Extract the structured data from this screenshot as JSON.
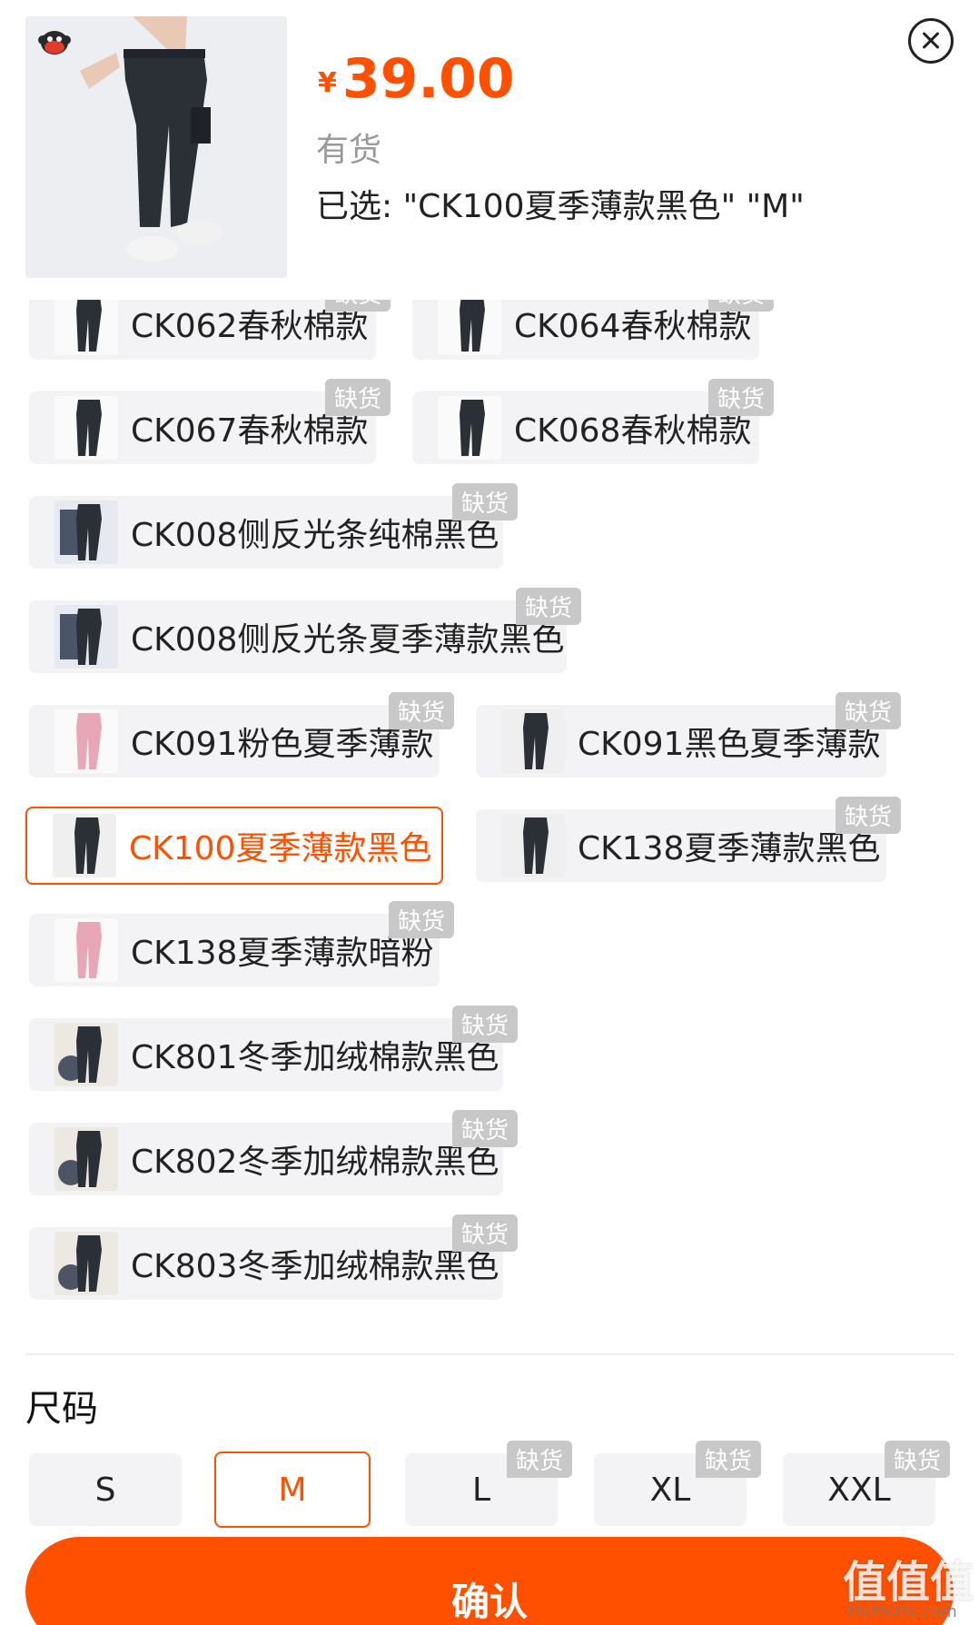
{
  "header": {
    "currency_symbol": "¥",
    "price": "39.00",
    "stock_status": "有货",
    "selected_text": "已选: \"CK100夏季薄款黑色\" \"M\""
  },
  "variants": [
    {
      "label": "CK062春秋棉款",
      "badge": "缺货",
      "thumb": "black-pants",
      "selected": false
    },
    {
      "label": "CK064春秋棉款",
      "badge": "缺货",
      "thumb": "black-pants-stripe",
      "selected": false
    },
    {
      "label": "CK067春秋棉款",
      "badge": "缺货",
      "thumb": "black-pants",
      "selected": false
    },
    {
      "label": "CK068春秋棉款",
      "badge": "缺货",
      "thumb": "black-pants",
      "selected": false
    },
    {
      "label": "CK008侧反光条纯棉黑色",
      "badge": "缺货",
      "thumb": "reflective-pants",
      "selected": false
    },
    {
      "label": "CK008侧反光条夏季薄款黑色",
      "badge": "缺货",
      "thumb": "reflective-pants",
      "selected": false
    },
    {
      "label": "CK091粉色夏季薄款",
      "badge": "缺货",
      "thumb": "pink-pants",
      "selected": false
    },
    {
      "label": "CK091黑色夏季薄款",
      "badge": "缺货",
      "thumb": "black-pants-model",
      "selected": false
    },
    {
      "label": "CK100夏季薄款黑色",
      "badge": "",
      "thumb": "black-pants-model",
      "selected": true
    },
    {
      "label": "CK138夏季薄款黑色",
      "badge": "缺货",
      "thumb": "black-pants-model",
      "selected": false
    },
    {
      "label": "CK138夏季薄款暗粉",
      "badge": "缺货",
      "thumb": "pink-pants",
      "selected": false
    },
    {
      "label": "CK801冬季加绒棉款黑色",
      "badge": "缺货",
      "thumb": "fleece-pants",
      "selected": false
    },
    {
      "label": "CK802冬季加绒棉款黑色",
      "badge": "缺货",
      "thumb": "fleece-pants",
      "selected": false
    },
    {
      "label": "CK803冬季加绒棉款黑色",
      "badge": "缺货",
      "thumb": "fleece-pants",
      "selected": false
    }
  ],
  "sizes": {
    "title": "尺码",
    "options": [
      {
        "label": "S",
        "badge": "",
        "selected": false
      },
      {
        "label": "M",
        "badge": "",
        "selected": true
      },
      {
        "label": "L",
        "badge": "缺货",
        "selected": false
      },
      {
        "label": "XL",
        "badge": "缺货",
        "selected": false
      },
      {
        "label": "XXL",
        "badge": "缺货",
        "selected": false
      }
    ]
  },
  "confirm_label": "确认",
  "watermark": {
    "main": "值值值",
    "sub": "zhizhizhi.com"
  },
  "colors": {
    "accent": "#ff5000",
    "badge": "#c8c8c8",
    "option_bg": "#f3f3f5"
  }
}
